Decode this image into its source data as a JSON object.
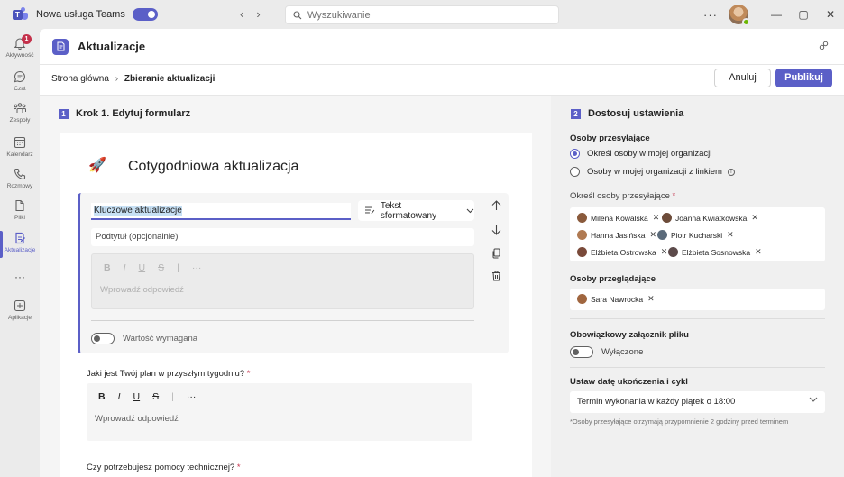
{
  "titlebar": {
    "new_teams_label": "Nowa usługa Teams",
    "search_placeholder": "Wyszukiwanie",
    "more_label": "···"
  },
  "rail": {
    "items": [
      {
        "label": "Aktywność",
        "badge": "1"
      },
      {
        "label": "Czat"
      },
      {
        "label": "Zespoły"
      },
      {
        "label": "Kalendarz"
      },
      {
        "label": "Rozmowy"
      },
      {
        "label": "Pliki"
      },
      {
        "label": "Aktualizacje"
      },
      {
        "label": "···"
      },
      {
        "label": "Aplikacje"
      }
    ],
    "active": "Aktualizacje",
    "accent": "#5b5fc7"
  },
  "app": {
    "title": "Aktualizacje"
  },
  "breadcrumb": {
    "home": "Strona główna",
    "separator": "›",
    "current": "Zbieranie aktualizacji"
  },
  "actions": {
    "cancel": "Anuluj",
    "publish": "Publikuj"
  },
  "form": {
    "step_num": "1",
    "step_title": "Krok 1. Edytuj formularz",
    "title": "Cotygodniowa aktualizacja",
    "question1": {
      "title_value": "Kluczowe aktualizacje",
      "type": "Tekst sformatowany",
      "subtitle_placeholder": "Podtytuł (opcjonalnie)",
      "answer_placeholder": "Wprowadź odpowiedź",
      "required_label": "Wartość wymagana",
      "required_on": false
    },
    "question2": {
      "label": "Jaki jest Twój plan w przyszłym tygodniu?",
      "required_mark": "*",
      "answer_placeholder": "Wprowadź odpowiedź"
    },
    "question3": {
      "label": "Czy potrzebujesz pomocy technicznej?",
      "required_mark": "*"
    },
    "format_toolbar": {
      "bold": "B",
      "italic": "I",
      "underline": "U",
      "strike": "S",
      "more": "···"
    }
  },
  "settings": {
    "step_num": "2",
    "step_title": "Dostosuj ustawienia",
    "submitters_label": "Osoby przesyłające",
    "radio_specific": "Określ osoby w mojej organizacji",
    "radio_link": "Osoby w mojej organizacji z linkiem",
    "radio_selected": "specific",
    "specify_label": "Określ osoby przesyłające",
    "required_mark": "*",
    "submitters": [
      {
        "name": "Milena Kowalska",
        "color": "#8a5a3c"
      },
      {
        "name": "Joanna Kwiatkowska",
        "color": "#6d4c3a"
      },
      {
        "name": "Hanna Jasińska",
        "color": "#b07a52"
      },
      {
        "name": "Piotr Kucharski",
        "color": "#5a6a7a"
      },
      {
        "name": "Elżbieta Ostrowska",
        "color": "#7a4a3a"
      },
      {
        "name": "Elżbieta Sosnowska",
        "color": "#5c4a4a"
      }
    ],
    "reviewers_label": "Osoby przeglądające",
    "reviewers": [
      {
        "name": "Sara Nawrocka",
        "color": "#a0663f"
      }
    ],
    "attachment_label": "Obowiązkowy załącznik pliku",
    "attachment_state": "Wyłączone",
    "attachment_on": false,
    "due_label": "Ustaw datę ukończenia i cykl",
    "due_value": "Termin wykonania w każdy piątek o 18:00",
    "note": "*Osoby przesyłające otrzymają przypomnienie 2 godziny przed terminem"
  }
}
